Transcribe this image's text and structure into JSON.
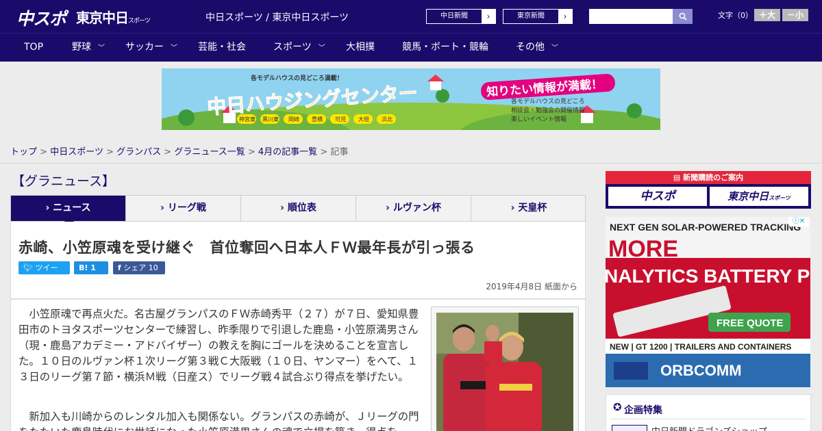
{
  "header": {
    "logo_chuspo": "中スポ",
    "logo_tokyo": "東京中日",
    "logo_tokyo_sub": "スポーツ",
    "site_title": "中日スポーツ / 東京中日スポーツ",
    "paper_links": [
      "中日新聞",
      "東京新聞"
    ],
    "search_placeholder": "",
    "fontsize_label": "文字（0）",
    "fontsize_up": "＋大",
    "fontsize_down": "－小"
  },
  "nav": {
    "items": [
      {
        "label": "TOP",
        "has_menu": false
      },
      {
        "label": "野球",
        "has_menu": true
      },
      {
        "label": "サッカー",
        "has_menu": true
      },
      {
        "label": "芸能・社会",
        "has_menu": false
      },
      {
        "label": "スポーツ",
        "has_menu": true
      },
      {
        "label": "大相撲",
        "has_menu": false
      },
      {
        "label": "競馬・ボート・競輪",
        "has_menu": false
      },
      {
        "label": "その他",
        "has_menu": true
      }
    ]
  },
  "banner": {
    "top_text": "各モデルハウスの見どころ満載！",
    "title": "中日ハウジングセンター",
    "badge": "知りたい情報が満載！",
    "bullets": [
      "各モデルハウスの見どころ",
      "相談会・勉強会の開催情報",
      "楽しいイベント情報"
    ],
    "locations": [
      "神宮東",
      "黒川東",
      "岡崎",
      "豊橋",
      "可児",
      "大垣",
      "浜北"
    ]
  },
  "breadcrumb": {
    "links": [
      "トップ",
      "中日スポーツ",
      "グランパス",
      "グラニュース一覧",
      "4月の記事一覧"
    ],
    "current": "記事",
    "separator": ">"
  },
  "section": {
    "title": "【グラニュース】"
  },
  "tabs": [
    {
      "label": "ニュース",
      "active": true
    },
    {
      "label": "リーグ戦",
      "active": false
    },
    {
      "label": "順位表",
      "active": false
    },
    {
      "label": "ルヴァン杯",
      "active": false
    },
    {
      "label": "天皇杯",
      "active": false
    }
  ],
  "article": {
    "headline": "赤崎、小笠原魂を受け継ぐ　首位奪回へ日本人ＦＷ最年長が引っ張る",
    "share": {
      "tweet": "ツイート",
      "hatena": "B! 1",
      "facebook": "シェア 10"
    },
    "date": "2019年4月8日 紙面から",
    "paragraphs": [
      "　小笠原魂で再点火だ。名古屋グランパスのＦＷ赤崎秀平（２７）が７日、愛知県豊田市のトヨタスポーツセンターで練習し、昨季限りで引退した鹿島・小笠原満男さん（現・鹿島アカデミー・アドバイザー）の教えを胸にゴールを決めることを宣言した。１０日のルヴァン杯１次リーグ第３戦Ｃ大阪戦（１０日、ヤンマー）をへて、１３日のリーグ第７節・横浜Ｍ戦（日産ス）でリーグ戦４試合ぶり得点を挙げたい。",
      "　新加入も川崎からのレンタル加入も関係ない。グランパスの赤崎が、Ｊリーグの門をたたいた鹿島時代にお世話になった小笠原満男さんの魂で立場を築き、得点を"
    ]
  },
  "sidebar": {
    "subscribe_title": "新聞購読のご案内",
    "subscribe_cards": [
      "中スポ",
      "東京中日"
    ],
    "subscribe_card_sub": "スポーツ",
    "ad": {
      "headline": "NEXT GEN SOLAR-POWERED TRACKING",
      "big1": "MORE",
      "big2": "NALYTICS  BATTERY P",
      "cta": "FREE QUOTE",
      "product": "NEW | GT 1200 | TRAILERS AND CONTAINERS",
      "brand": "ORBCOMM"
    },
    "feature_title": "企画特集",
    "feature_item": "中日新聞ドラゴンズショップ"
  },
  "colors": {
    "brand_navy": "#1a0b6b",
    "accent_red": "#e3263b",
    "twitter": "#1da1f2",
    "hatena": "#1e8fe0",
    "facebook": "#3b5998"
  }
}
